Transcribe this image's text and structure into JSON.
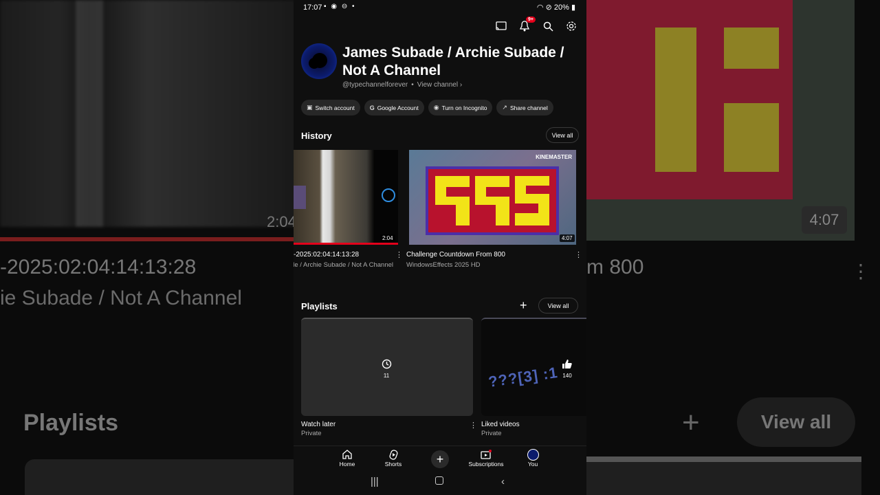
{
  "status_bar": {
    "time": "17:07",
    "battery": "20%"
  },
  "channel": {
    "name": "James Subade / Archie Subade / Not A Channel",
    "handle": "@typechannelforever",
    "view_channel": "View channel"
  },
  "notifications_badge": "9+",
  "chips": [
    {
      "label": "Switch account",
      "icon": "switch-account-icon"
    },
    {
      "label": "Google Account",
      "icon": "google-icon"
    },
    {
      "label": "Turn on Incognito",
      "icon": "incognito-icon"
    },
    {
      "label": "Share channel",
      "icon": "share-icon"
    }
  ],
  "history": {
    "title": "History",
    "view_all": "View all",
    "videos": [
      {
        "title": "-2025:02:04:14:13:28",
        "channel": "James Subade / Archie Subade / Not A Channel",
        "duration": "2:04"
      },
      {
        "title": "Challenge Countdown From 800",
        "channel": "WindowsEffects 2025 HD",
        "duration": "4:07",
        "watermark": "KINEMASTER"
      }
    ]
  },
  "playlists": {
    "title": "Playlists",
    "view_all": "View all",
    "items": [
      {
        "title": "Watch later",
        "privacy": "Private",
        "count": "11",
        "icon": "clock-icon"
      },
      {
        "title": "Liked videos",
        "privacy": "Private",
        "count": "140",
        "icon": "thumbs-up-icon",
        "thumb_text": "???[3] :1"
      }
    ]
  },
  "nav": {
    "home": "Home",
    "shorts": "Shorts",
    "subscriptions": "Subscriptions",
    "you": "You"
  },
  "background": {
    "left_duration": "2:04",
    "left_line1": "-2025:02:04:14:13:28",
    "left_line2": "ie Subade / Not A Channel",
    "left_playlists": "Playlists",
    "right_duration": "4:07",
    "right_title": "m 800",
    "right_view_all": "View all"
  }
}
